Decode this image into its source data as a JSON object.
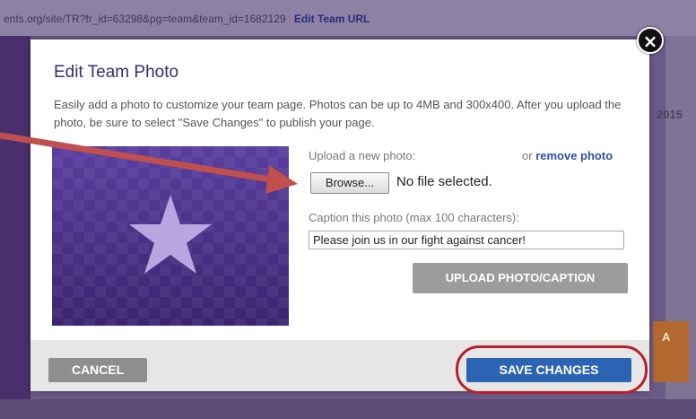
{
  "background": {
    "url": "ents.org/site/TR?fr_id=63298&pg=team&team_id=1682129",
    "edit_team_url": "Edit Team URL",
    "year_partial": "2015",
    "orange_letter": "A"
  },
  "modal": {
    "title": "Edit Team Photo",
    "description": "Easily add a photo to customize your team page. Photos can be up to 4MB and 300x400. After you upload the photo, be sure to select \"Save Changes\" to publish your page.",
    "photo_icon": "star-icon",
    "upload_label": "Upload a new photo:",
    "or_text": "or",
    "remove_photo": "remove photo",
    "browse_label": "Browse...",
    "no_file_text": "No file selected.",
    "caption_label": "Caption this photo (max 100 characters):",
    "caption_value": "Please join us in our fight against cancer!",
    "upload_button": "UPLOAD PHOTO/CAPTION",
    "cancel_button": "CANCEL",
    "save_button": "SAVE CHANGES",
    "close_icon": "close-icon",
    "close_glyph": "×"
  },
  "colors": {
    "title": "#3d2a6b",
    "save": "#2c64b4",
    "highlight": "#b8202a",
    "arrow": "#c0504d"
  }
}
